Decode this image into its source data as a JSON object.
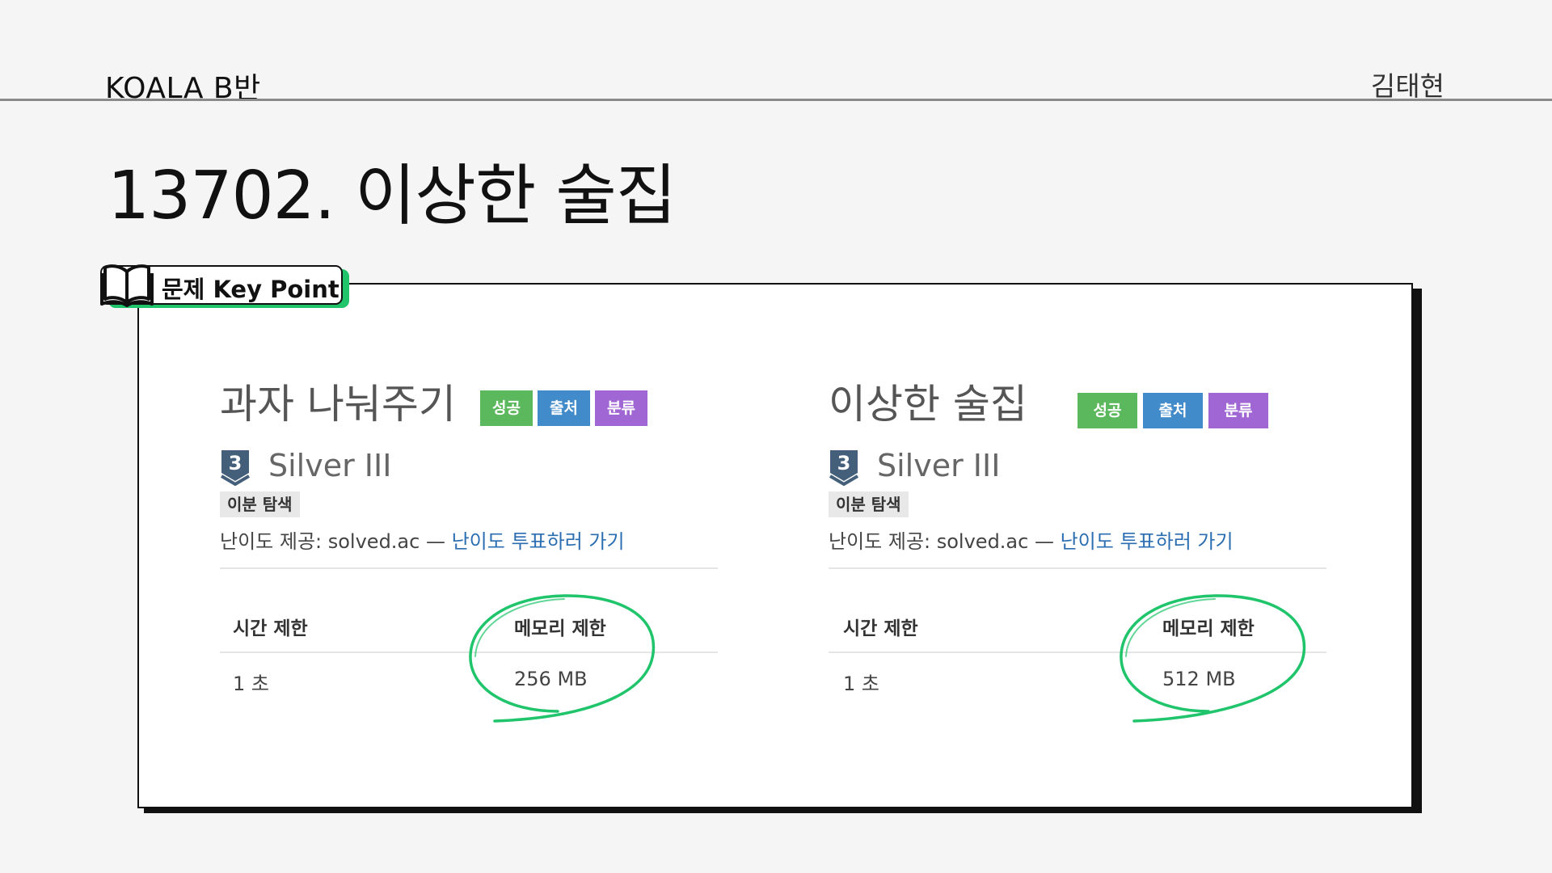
{
  "header": {
    "left": "KOALA B반",
    "right": "김태현"
  },
  "page_title": "13702. 이상한 술집",
  "key_point": {
    "label": "문제 Key Point",
    "icon": "open-book-icon"
  },
  "accent_colors": {
    "highlight": "#1fc46b",
    "tag_success": "#5cb85c",
    "tag_source": "#428bca",
    "tag_category": "#9f66d4"
  },
  "problems": [
    {
      "title": "과자 나눠주기",
      "tags": [
        "성공",
        "출처",
        "분류"
      ],
      "tier_number": "3",
      "tier": "Silver III",
      "algorithm_badge": "이분 탐색",
      "credit_prefix": "난이도 제공: solved.ac — ",
      "credit_link": "난이도 투표하러 가기",
      "time_header": "시간 제한",
      "memory_header": "메모리 제한",
      "time_value": "1 초",
      "memory_value": "256 MB"
    },
    {
      "title": "이상한 술집",
      "tags": [
        "성공",
        "출처",
        "분류"
      ],
      "tier_number": "3",
      "tier": "Silver III",
      "algorithm_badge": "이분 탐색",
      "credit_prefix": "난이도 제공: solved.ac — ",
      "credit_link": "난이도 투표하러 가기",
      "time_header": "시간 제한",
      "memory_header": "메모리 제한",
      "time_value": "1 초",
      "memory_value": "512 MB"
    }
  ]
}
